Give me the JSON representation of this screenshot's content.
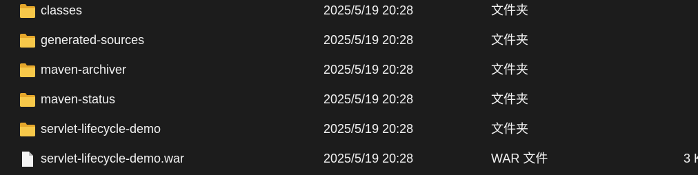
{
  "colors": {
    "background": "#1c1c1c",
    "text": "#f2f2f2",
    "folder_front": "#f7c84a",
    "folder_back": "#e5a72b",
    "file_icon": "#f3f3f3"
  },
  "files": [
    {
      "name": "classes",
      "modified": "2025/5/19 20:28",
      "type": "文件夹",
      "size": "",
      "icon": "folder-icon"
    },
    {
      "name": "generated-sources",
      "modified": "2025/5/19 20:28",
      "type": "文件夹",
      "size": "",
      "icon": "folder-icon"
    },
    {
      "name": "maven-archiver",
      "modified": "2025/5/19 20:28",
      "type": "文件夹",
      "size": "",
      "icon": "folder-icon"
    },
    {
      "name": "maven-status",
      "modified": "2025/5/19 20:28",
      "type": "文件夹",
      "size": "",
      "icon": "folder-icon"
    },
    {
      "name": "servlet-lifecycle-demo",
      "modified": "2025/5/19 20:28",
      "type": "文件夹",
      "size": "",
      "icon": "folder-icon"
    },
    {
      "name": "servlet-lifecycle-demo.war",
      "modified": "2025/5/19 20:28",
      "type": "WAR 文件",
      "size": "3 K",
      "icon": "file-icon"
    }
  ]
}
